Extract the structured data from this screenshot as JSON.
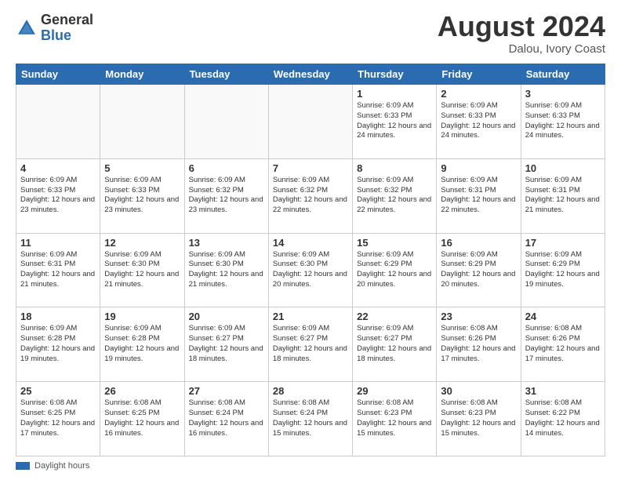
{
  "header": {
    "logo_general": "General",
    "logo_blue": "Blue",
    "month_title": "August 2024",
    "location": "Dalou, Ivory Coast"
  },
  "legend": {
    "label": "Daylight hours"
  },
  "days_of_week": [
    "Sunday",
    "Monday",
    "Tuesday",
    "Wednesday",
    "Thursday",
    "Friday",
    "Saturday"
  ],
  "weeks": [
    [
      {
        "day": "",
        "info": ""
      },
      {
        "day": "",
        "info": ""
      },
      {
        "day": "",
        "info": ""
      },
      {
        "day": "",
        "info": ""
      },
      {
        "day": "1",
        "info": "Sunrise: 6:09 AM\nSunset: 6:33 PM\nDaylight: 12 hours\nand 24 minutes."
      },
      {
        "day": "2",
        "info": "Sunrise: 6:09 AM\nSunset: 6:33 PM\nDaylight: 12 hours\nand 24 minutes."
      },
      {
        "day": "3",
        "info": "Sunrise: 6:09 AM\nSunset: 6:33 PM\nDaylight: 12 hours\nand 24 minutes."
      }
    ],
    [
      {
        "day": "4",
        "info": "Sunrise: 6:09 AM\nSunset: 6:33 PM\nDaylight: 12 hours\nand 23 minutes."
      },
      {
        "day": "5",
        "info": "Sunrise: 6:09 AM\nSunset: 6:33 PM\nDaylight: 12 hours\nand 23 minutes."
      },
      {
        "day": "6",
        "info": "Sunrise: 6:09 AM\nSunset: 6:32 PM\nDaylight: 12 hours\nand 23 minutes."
      },
      {
        "day": "7",
        "info": "Sunrise: 6:09 AM\nSunset: 6:32 PM\nDaylight: 12 hours\nand 22 minutes."
      },
      {
        "day": "8",
        "info": "Sunrise: 6:09 AM\nSunset: 6:32 PM\nDaylight: 12 hours\nand 22 minutes."
      },
      {
        "day": "9",
        "info": "Sunrise: 6:09 AM\nSunset: 6:31 PM\nDaylight: 12 hours\nand 22 minutes."
      },
      {
        "day": "10",
        "info": "Sunrise: 6:09 AM\nSunset: 6:31 PM\nDaylight: 12 hours\nand 21 minutes."
      }
    ],
    [
      {
        "day": "11",
        "info": "Sunrise: 6:09 AM\nSunset: 6:31 PM\nDaylight: 12 hours\nand 21 minutes."
      },
      {
        "day": "12",
        "info": "Sunrise: 6:09 AM\nSunset: 6:30 PM\nDaylight: 12 hours\nand 21 minutes."
      },
      {
        "day": "13",
        "info": "Sunrise: 6:09 AM\nSunset: 6:30 PM\nDaylight: 12 hours\nand 21 minutes."
      },
      {
        "day": "14",
        "info": "Sunrise: 6:09 AM\nSunset: 6:30 PM\nDaylight: 12 hours\nand 20 minutes."
      },
      {
        "day": "15",
        "info": "Sunrise: 6:09 AM\nSunset: 6:29 PM\nDaylight: 12 hours\nand 20 minutes."
      },
      {
        "day": "16",
        "info": "Sunrise: 6:09 AM\nSunset: 6:29 PM\nDaylight: 12 hours\nand 20 minutes."
      },
      {
        "day": "17",
        "info": "Sunrise: 6:09 AM\nSunset: 6:29 PM\nDaylight: 12 hours\nand 19 minutes."
      }
    ],
    [
      {
        "day": "18",
        "info": "Sunrise: 6:09 AM\nSunset: 6:28 PM\nDaylight: 12 hours\nand 19 minutes."
      },
      {
        "day": "19",
        "info": "Sunrise: 6:09 AM\nSunset: 6:28 PM\nDaylight: 12 hours\nand 19 minutes."
      },
      {
        "day": "20",
        "info": "Sunrise: 6:09 AM\nSunset: 6:27 PM\nDaylight: 12 hours\nand 18 minutes."
      },
      {
        "day": "21",
        "info": "Sunrise: 6:09 AM\nSunset: 6:27 PM\nDaylight: 12 hours\nand 18 minutes."
      },
      {
        "day": "22",
        "info": "Sunrise: 6:09 AM\nSunset: 6:27 PM\nDaylight: 12 hours\nand 18 minutes."
      },
      {
        "day": "23",
        "info": "Sunrise: 6:08 AM\nSunset: 6:26 PM\nDaylight: 12 hours\nand 17 minutes."
      },
      {
        "day": "24",
        "info": "Sunrise: 6:08 AM\nSunset: 6:26 PM\nDaylight: 12 hours\nand 17 minutes."
      }
    ],
    [
      {
        "day": "25",
        "info": "Sunrise: 6:08 AM\nSunset: 6:25 PM\nDaylight: 12 hours\nand 17 minutes."
      },
      {
        "day": "26",
        "info": "Sunrise: 6:08 AM\nSunset: 6:25 PM\nDaylight: 12 hours\nand 16 minutes."
      },
      {
        "day": "27",
        "info": "Sunrise: 6:08 AM\nSunset: 6:24 PM\nDaylight: 12 hours\nand 16 minutes."
      },
      {
        "day": "28",
        "info": "Sunrise: 6:08 AM\nSunset: 6:24 PM\nDaylight: 12 hours\nand 15 minutes."
      },
      {
        "day": "29",
        "info": "Sunrise: 6:08 AM\nSunset: 6:23 PM\nDaylight: 12 hours\nand 15 minutes."
      },
      {
        "day": "30",
        "info": "Sunrise: 6:08 AM\nSunset: 6:23 PM\nDaylight: 12 hours\nand 15 minutes."
      },
      {
        "day": "31",
        "info": "Sunrise: 6:08 AM\nSunset: 6:22 PM\nDaylight: 12 hours\nand 14 minutes."
      }
    ]
  ]
}
